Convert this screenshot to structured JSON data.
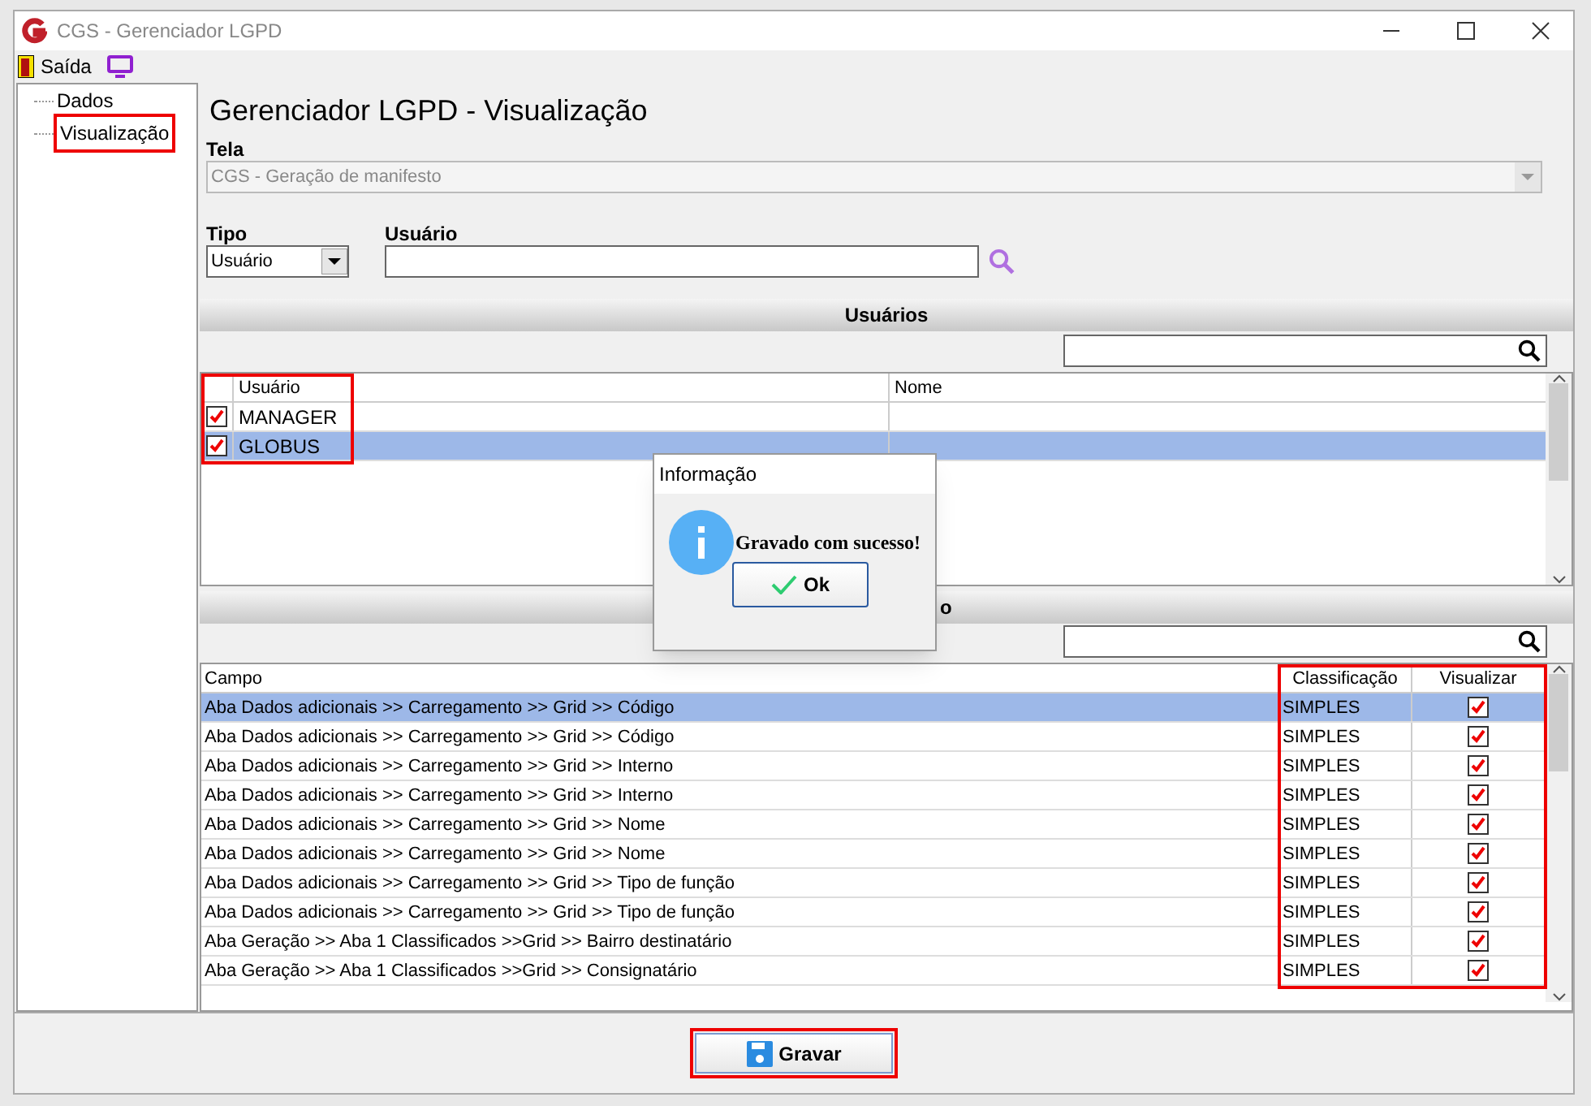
{
  "window": {
    "title": "CGS - Gerenciador LGPD"
  },
  "menu": [
    {
      "kind": "exit",
      "label": "Saída"
    },
    {
      "kind": "monitor"
    }
  ],
  "tree": [
    {
      "label": "Dados",
      "highlighted": false
    },
    {
      "label": "Visualização",
      "highlighted": true
    }
  ],
  "page_title": "Gerenciador LGPD - Visualização",
  "tela": {
    "label": "Tela",
    "value": "CGS - Geração de manifesto"
  },
  "tipo": {
    "label": "Tipo",
    "value": "Usuário"
  },
  "usuario": {
    "label": "Usuário"
  },
  "users_section": {
    "title": "Usuários",
    "highlighted": true,
    "columns": [
      "Usuário",
      "Nome"
    ],
    "rows": [
      {
        "usuario": "MANAGER",
        "checked": true,
        "selected": false
      },
      {
        "usuario": "GLOBUS",
        "checked": true,
        "selected": true
      }
    ]
  },
  "fields_section": {
    "title_visible": "o",
    "highlighted": true,
    "columns": [
      "Campo",
      "Classificação",
      "Visualizar"
    ],
    "rows": [
      {
        "campo": "Aba Dados adicionais >> Carregamento >> Grid >> Código",
        "classificacao": "SIMPLES",
        "visualizar": true,
        "selected": true
      },
      {
        "campo": "Aba Dados adicionais >> Carregamento >> Grid >> Código",
        "classificacao": "SIMPLES",
        "visualizar": true,
        "selected": false
      },
      {
        "campo": "Aba Dados adicionais >> Carregamento >> Grid >> Interno",
        "classificacao": "SIMPLES",
        "visualizar": true,
        "selected": false
      },
      {
        "campo": "Aba Dados adicionais >> Carregamento >> Grid >> Interno",
        "classificacao": "SIMPLES",
        "visualizar": true,
        "selected": false
      },
      {
        "campo": "Aba Dados adicionais >> Carregamento >> Grid >> Nome",
        "classificacao": "SIMPLES",
        "visualizar": true,
        "selected": false
      },
      {
        "campo": "Aba Dados adicionais >> Carregamento >> Grid >> Nome",
        "classificacao": "SIMPLES",
        "visualizar": true,
        "selected": false
      },
      {
        "campo": "Aba Dados adicionais >> Carregamento >> Grid >> Tipo de função",
        "classificacao": "SIMPLES",
        "visualizar": true,
        "selected": false
      },
      {
        "campo": "Aba Dados adicionais >> Carregamento >> Grid >> Tipo de função",
        "classificacao": "SIMPLES",
        "visualizar": true,
        "selected": false
      },
      {
        "campo": "Aba Geração >> Aba 1 Classificados >>Grid >> Bairro destinatário",
        "classificacao": "SIMPLES",
        "visualizar": true,
        "selected": false
      },
      {
        "campo": "Aba Geração >> Aba 1 Classificados >>Grid >> Consignatário",
        "classificacao": "SIMPLES",
        "visualizar": true,
        "selected": false
      }
    ]
  },
  "dialog": {
    "title": "Informação",
    "message": "Gravado com sucesso!",
    "button": "Ok"
  },
  "save_button": {
    "label": "Gravar",
    "highlighted": true
  }
}
